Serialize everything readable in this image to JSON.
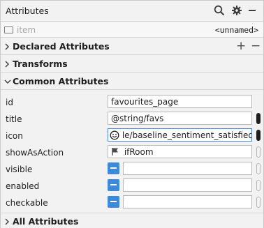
{
  "panel": {
    "title": "Attributes",
    "icons": [
      "search-icon",
      "gear-icon",
      "minimize-icon"
    ]
  },
  "item": {
    "label": "item",
    "value": "<unnamed>"
  },
  "sections": {
    "declared": {
      "label": "Declared Attributes",
      "add": "+",
      "remove": "−"
    },
    "transforms": {
      "label": "Transforms"
    },
    "common": {
      "label": "Common Attributes"
    },
    "all": {
      "label": "All Attributes"
    }
  },
  "attributes": [
    {
      "name": "id",
      "value": "favourites_page",
      "type": "text"
    },
    {
      "name": "title",
      "value": "@string/favs",
      "type": "text"
    },
    {
      "name": "icon",
      "value": "le/baseline_sentiment_satisfied_alt_",
      "type": "text",
      "icon": "smiley-icon"
    },
    {
      "name": "showAsAction",
      "value": "ifRoom",
      "type": "text",
      "icon": "flag-icon"
    },
    {
      "name": "visible",
      "value": "",
      "type": "tristate"
    },
    {
      "name": "enabled",
      "value": "",
      "type": "tristate"
    },
    {
      "name": "checkable",
      "value": "",
      "type": "tristate"
    }
  ],
  "colors": {
    "accent": "#3d8adb",
    "background": "#f2f2f2",
    "border": "#d6d6d6"
  }
}
